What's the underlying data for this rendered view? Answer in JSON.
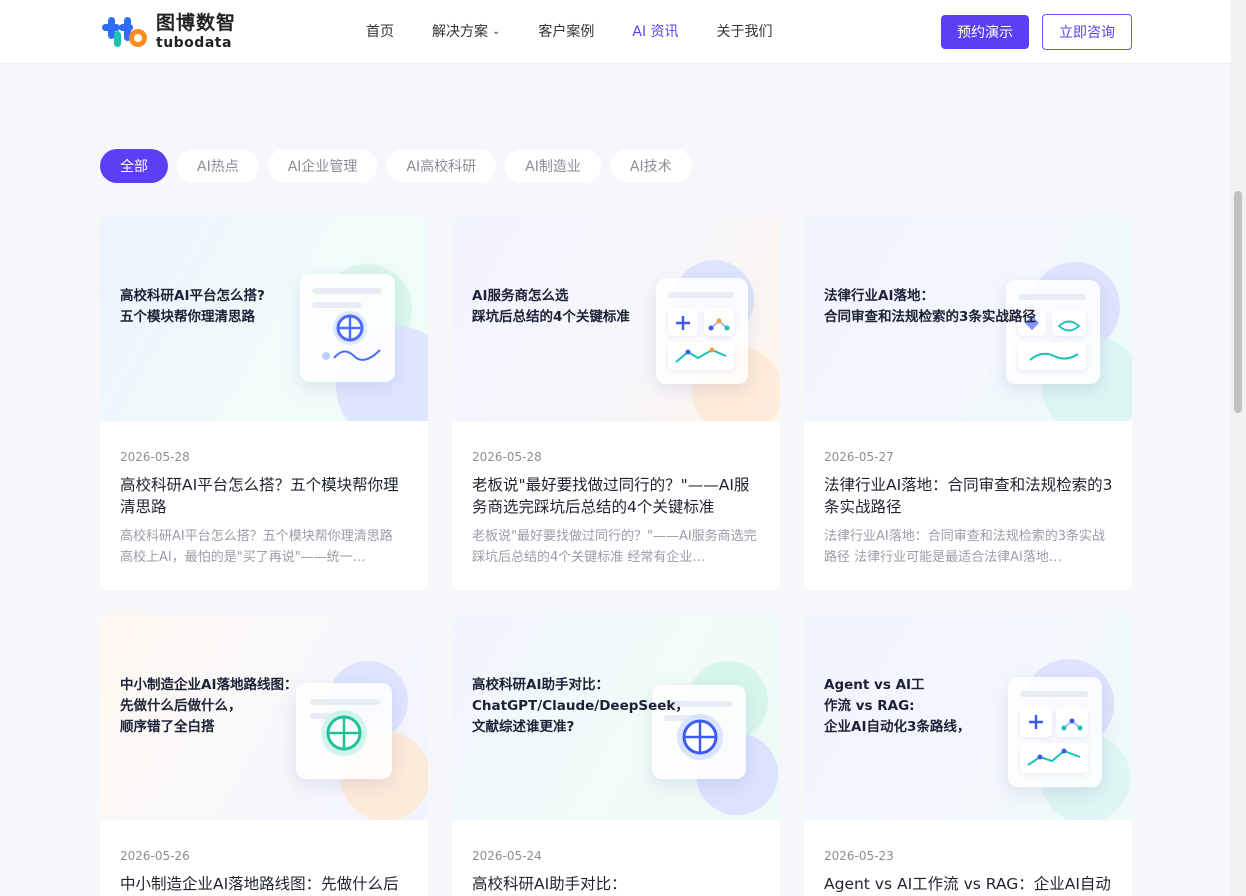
{
  "header": {
    "logo_cn": "图博数智",
    "logo_en": "tubodata",
    "nav": [
      {
        "label": "首页",
        "active": false,
        "has_dropdown": false
      },
      {
        "label": "解决方案",
        "active": false,
        "has_dropdown": true
      },
      {
        "label": "客户案例",
        "active": false,
        "has_dropdown": false
      },
      {
        "label": "AI 资讯",
        "active": true,
        "has_dropdown": false
      },
      {
        "label": "关于我们",
        "active": false,
        "has_dropdown": false
      }
    ],
    "demo_button": "预约演示",
    "consult_button": "立即咨询"
  },
  "filters": [
    "全部",
    "AI热点",
    "AI企业管理",
    "AI高校科研",
    "AI制造业",
    "AI技术"
  ],
  "active_filter": "全部",
  "articles": [
    {
      "thumb_title": "高校科研AI平台怎么搭?\n五个模块帮你理清思路",
      "date": "2026-05-28",
      "title": "高校科研AI平台怎么搭？五个模块帮你理清思路",
      "summary": "高校科研AI平台怎么搭？五个模块帮你理清思路 高校上AI，最怕的是\"买了再说\"——统一…"
    },
    {
      "thumb_title": "AI服务商怎么选\n踩坑后总结的4个关键标准",
      "date": "2026-05-28",
      "title": "老板说\"最好要找做过同行的？\"——AI服务商选完踩坑后总结的4个关键标准",
      "summary": "老板说\"最好要找做过同行的？\"——AI服务商选完踩坑后总结的4个关键标准 经常有企业…"
    },
    {
      "thumb_title": "法律行业AI落地：\n合同审查和法规检索的3条实战路径",
      "date": "2026-05-27",
      "title": "法律行业AI落地：合同审查和法规检索的3条实战路径",
      "summary": "法律行业AI落地：合同审查和法规检索的3条实战路径 法律行业可能是最适合法律AI落地…"
    },
    {
      "thumb_title": "中小制造企业AI落地路线图：\n先做什么后做什么，\n顺序错了全白搭",
      "date": "2026-05-26",
      "title": "中小制造企业AI落地路线图：先做什么后",
      "summary": ""
    },
    {
      "thumb_title": "高校科研AI助手对比：\nChatGPT/Claude/DeepSeek，\n文献综述谁更准?",
      "date": "2026-05-24",
      "title": "高校科研AI助手对比：",
      "summary": ""
    },
    {
      "thumb_title": "Agent vs AI工\n作流 vs RAG:\n企业AI自动化3条路线，",
      "date": "2026-05-23",
      "title": "Agent vs AI工作流 vs RAG：企业AI自动",
      "summary": ""
    }
  ],
  "colors": {
    "brand": "#5b3ff5",
    "logo_blue": "#2f6df6",
    "logo_teal": "#19c2b3",
    "logo_orange": "#ff8a1f"
  }
}
